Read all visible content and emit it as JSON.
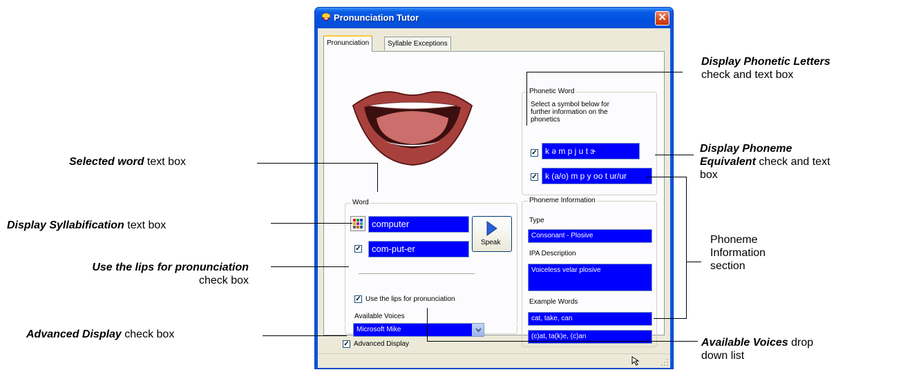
{
  "window": {
    "title": "Pronunciation Tutor",
    "close_glyph": "✕",
    "icon": "pronunciation-tutor-icon"
  },
  "tabs": [
    {
      "label": "Pronunciation",
      "active": true
    },
    {
      "label": "Syllable Exceptions",
      "active": false
    }
  ],
  "phonetic": {
    "group_title": "Phonetic Word",
    "instructions": "Select a symbol below for further information on the phonetics",
    "phonetic_letters": "k ə m p j u t ɝ",
    "phonetic_letters_checked": true,
    "phoneme_equivalent": "k (a/o) m p y oo t ur/ur",
    "phoneme_equivalent_checked": true
  },
  "word": {
    "group_title": "Word",
    "selected_word": "computer",
    "syllabification": "com-put-er",
    "syllabification_checked": true,
    "speak_label": "Speak",
    "lips_label": "Use the lips for pronunciation",
    "lips_checked": true,
    "voices_label": "Available Voices",
    "voice_selected": "Microsoft Mike"
  },
  "phoneme_info": {
    "group_title": "Phoneme Information",
    "type_label": "Type",
    "type_value": "Consonant - Plosive",
    "ipa_label": "IPA Description",
    "ipa_value": "Voiceless velar plosive",
    "examples_label": "Example Words",
    "examples_value": "cat, take, can",
    "examples_marked": "(c)at, ta(k)e, (c)an"
  },
  "advanced": {
    "label": "Advanced Display",
    "checked": true
  },
  "callouts": {
    "selected_word": {
      "bold": "Selected word",
      "rest": " text box"
    },
    "syllabification": {
      "bold": "Display Syllabification",
      "rest": " text box"
    },
    "lips": {
      "bold": "Use the lips for pronunciation",
      "rest": "check box"
    },
    "advanced": {
      "bold": "Advanced Display",
      "rest": " check box"
    },
    "phonetic_letters": {
      "bold": "Display Phonetic Letters",
      "rest": "check and text box"
    },
    "phoneme_equiv": {
      "bold1": "Display Phoneme",
      "bold2": "Equivalent",
      "rest1": " check and text",
      "rest2": "box"
    },
    "phoneme_info": {
      "line1": "Phoneme",
      "line2": "Information",
      "line3": "section"
    },
    "voices": {
      "bold": "Available Voices",
      "rest1": " drop",
      "rest2": "down list"
    }
  },
  "colors": {
    "title_bar": "#0a55e0",
    "field_blue": "#0000ff",
    "dialog_bg": "#ece9d8",
    "close_button": "#d9471c",
    "tab_highlight": "#ffc83c"
  }
}
